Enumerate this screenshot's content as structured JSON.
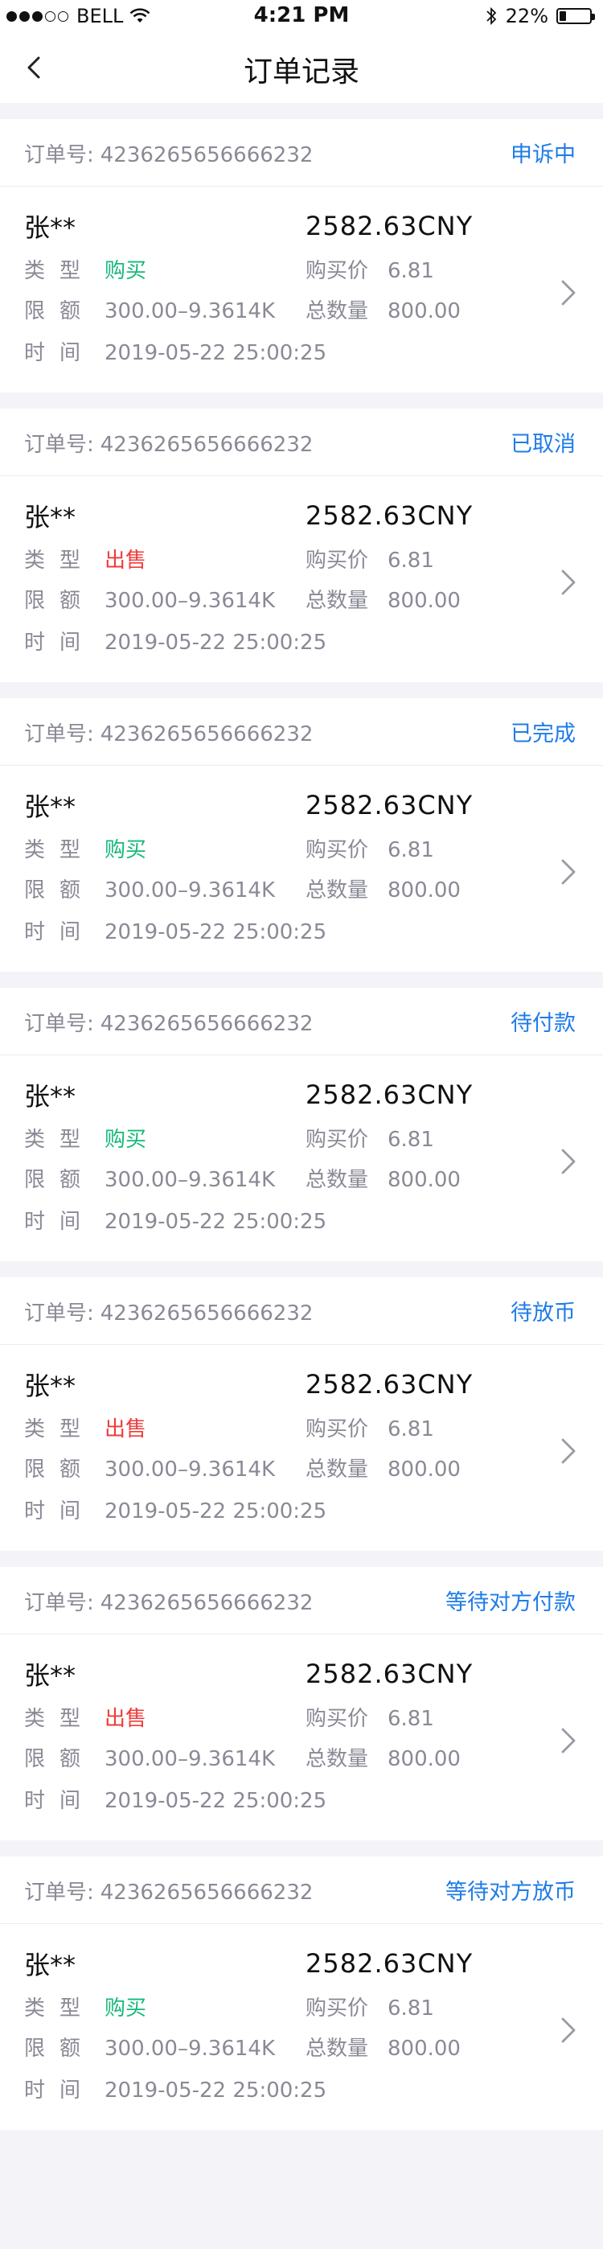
{
  "status_bar": {
    "carrier": "BELL",
    "time": "4:21 PM",
    "battery": "22%",
    "battery_level": 0.22
  },
  "nav": {
    "title": "订单记录"
  },
  "labels": {
    "order_no": "订单号:",
    "type": "类型",
    "limit": "限额",
    "time": "时间",
    "price": "购买价",
    "total": "总数量"
  },
  "orders": [
    {
      "order_no": "4236265656666232",
      "status": "申诉中",
      "name": "张**",
      "amount": "2582.63CNY",
      "type": "购买",
      "type_kind": "buy",
      "price": "6.81",
      "limit": "300.00–9.3614K",
      "total": "800.00",
      "time": "2019-05-22 25:00:25"
    },
    {
      "order_no": "4236265656666232",
      "status": "已取消",
      "name": "张**",
      "amount": "2582.63CNY",
      "type": "出售",
      "type_kind": "sell",
      "price": "6.81",
      "limit": "300.00–9.3614K",
      "total": "800.00",
      "time": "2019-05-22 25:00:25"
    },
    {
      "order_no": "4236265656666232",
      "status": "已完成",
      "name": "张**",
      "amount": "2582.63CNY",
      "type": "购买",
      "type_kind": "buy",
      "price": "6.81",
      "limit": "300.00–9.3614K",
      "total": "800.00",
      "time": "2019-05-22 25:00:25"
    },
    {
      "order_no": "4236265656666232",
      "status": "待付款",
      "name": "张**",
      "amount": "2582.63CNY",
      "type": "购买",
      "type_kind": "buy",
      "price": "6.81",
      "limit": "300.00–9.3614K",
      "total": "800.00",
      "time": "2019-05-22 25:00:25"
    },
    {
      "order_no": "4236265656666232",
      "status": "待放币",
      "name": "张**",
      "amount": "2582.63CNY",
      "type": "出售",
      "type_kind": "sell",
      "price": "6.81",
      "limit": "300.00–9.3614K",
      "total": "800.00",
      "time": "2019-05-22 25:00:25"
    },
    {
      "order_no": "4236265656666232",
      "status": "等待对方付款",
      "name": "张**",
      "amount": "2582.63CNY",
      "type": "出售",
      "type_kind": "sell",
      "price": "6.81",
      "limit": "300.00–9.3614K",
      "total": "800.00",
      "time": "2019-05-22 25:00:25"
    },
    {
      "order_no": "4236265656666232",
      "status": "等待对方放币",
      "name": "张**",
      "amount": "2582.63CNY",
      "type": "购买",
      "type_kind": "buy",
      "price": "6.81",
      "limit": "300.00–9.3614K",
      "total": "800.00",
      "time": "2019-05-22 25:00:25"
    }
  ]
}
